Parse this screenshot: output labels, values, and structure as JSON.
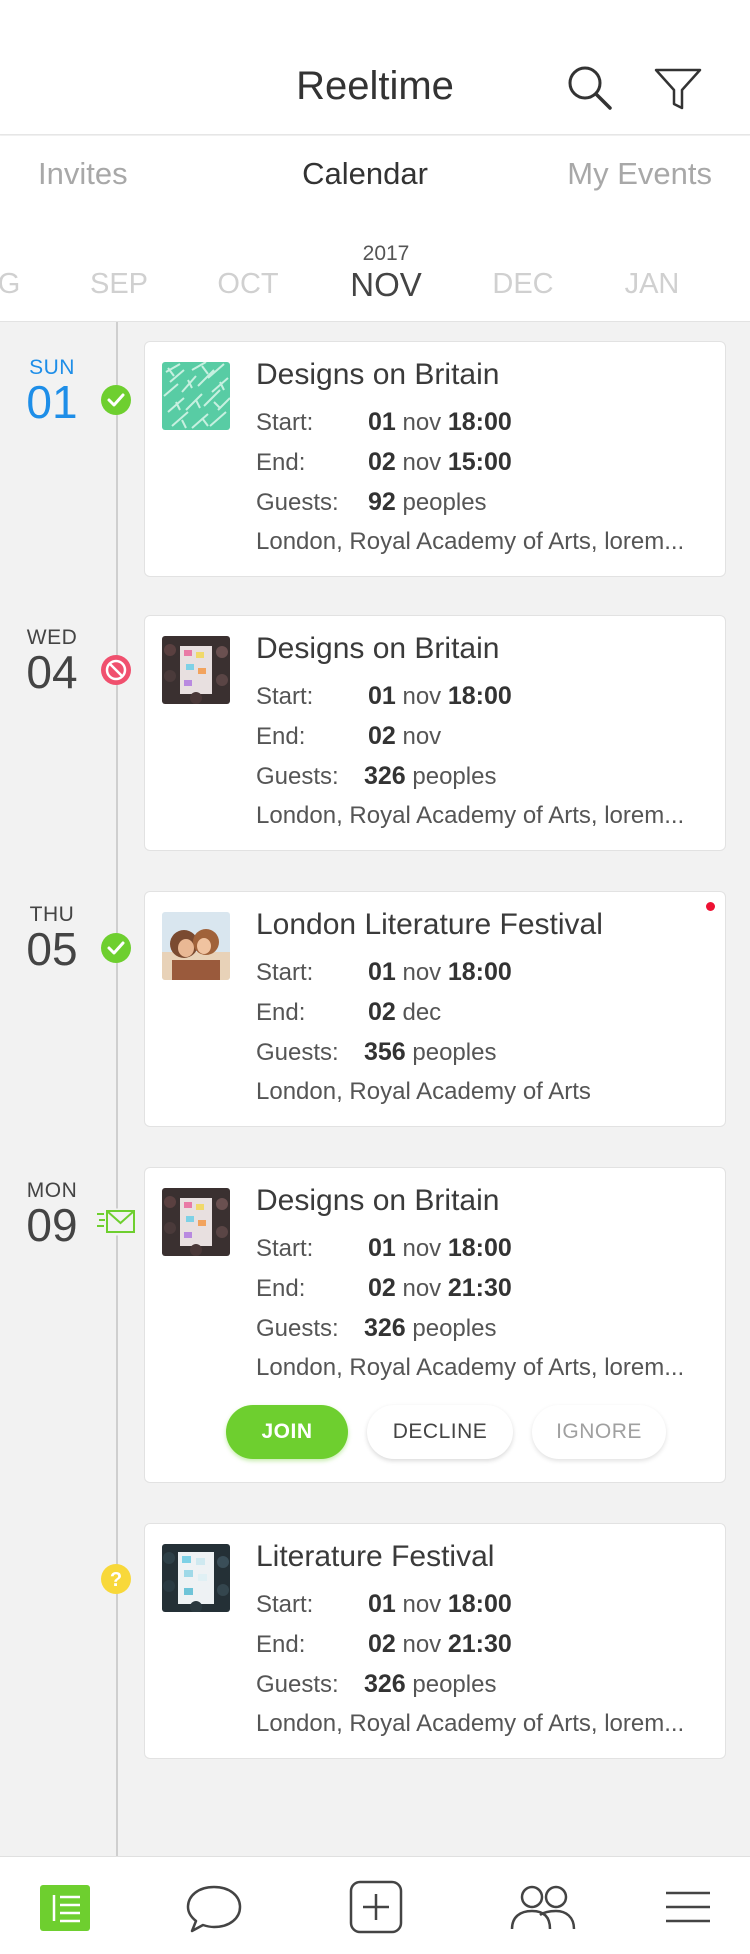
{
  "header": {
    "title": "Reeltime",
    "search_icon": "search-icon",
    "filter_icon": "filter-icon"
  },
  "tabs": [
    {
      "label": "Invites",
      "active": false
    },
    {
      "label": "Calendar",
      "active": true
    },
    {
      "label": "My Events",
      "active": false
    }
  ],
  "months": {
    "year": "2017",
    "items": [
      "G",
      "SEP",
      "OCT",
      "NOV",
      "DEC",
      "JAN"
    ],
    "selected": "NOV"
  },
  "colors": {
    "accent_green": "#6ecf2f",
    "today_blue": "#1e8ee8",
    "declined_red": "#f0506e",
    "pending_yellow": "#f8d83a",
    "unread_red": "#ee1133"
  },
  "labels": {
    "start": "Start:",
    "end": "End:",
    "guests": "Guests:"
  },
  "events": [
    {
      "day": {
        "dow": "SUN",
        "num": "01",
        "today": true
      },
      "status": "accepted-check-icon",
      "thumb": "pattern-thumbnail",
      "title": "Designs on Britain",
      "start": {
        "day": "01",
        "mon": "nov",
        "time": "18:00"
      },
      "end": {
        "day": "02",
        "mon": "nov",
        "time": "15:00"
      },
      "guests": {
        "count": "92",
        "unit": "peoples"
      },
      "address": "London, Royal Academy of Arts, lorem..."
    },
    {
      "day": {
        "dow": "WED",
        "num": "04",
        "today": false
      },
      "status": "declined-block-icon",
      "thumb": "crowd-photo-thumbnail",
      "title": "Designs on Britain",
      "start": {
        "day": "01",
        "mon": "nov",
        "time": "18:00"
      },
      "end": {
        "day": "02",
        "mon": "nov",
        "time": ""
      },
      "guests": {
        "count": "326",
        "unit": "peoples"
      },
      "address": "London, Royal Academy of Arts, lorem..."
    },
    {
      "day": {
        "dow": "THU",
        "num": "05",
        "today": false
      },
      "status": "accepted-check-icon",
      "thumb": "couple-photo-thumbnail",
      "title": "London Literature Festival",
      "start": {
        "day": "01",
        "mon": "nov",
        "time": "18:00"
      },
      "end": {
        "day": "02",
        "mon": "dec",
        "time": ""
      },
      "guests": {
        "count": "356",
        "unit": "peoples"
      },
      "address": "London, Royal Academy  of Arts",
      "unread": true
    },
    {
      "day": {
        "dow": "MON",
        "num": "09",
        "today": false
      },
      "status": "invite-envelope-icon",
      "thumb": "crowd-photo-thumbnail",
      "title": "Designs on Britain",
      "start": {
        "day": "01",
        "mon": "nov",
        "time": "18:00"
      },
      "end": {
        "day": "02",
        "mon": "nov",
        "time": "21:30"
      },
      "guests": {
        "count": "326",
        "unit": "peoples"
      },
      "address": "London, Royal Academy of Arts, lorem...",
      "actions": {
        "join": "JOIN",
        "decline": "DECLINE",
        "ignore": "IGNORE"
      }
    },
    {
      "day": {
        "dow": "",
        "num": "",
        "today": false
      },
      "status": "pending-question-icon",
      "thumb": "crowd-photo-thumbnail",
      "title": "Literature Festival",
      "start": {
        "day": "01",
        "mon": "nov",
        "time": "18:00"
      },
      "end": {
        "day": "02",
        "mon": "nov",
        "time": "21:30"
      },
      "guests": {
        "count": "326",
        "unit": "peoples"
      },
      "address": "London, Royal Academy of Arts, lorem..."
    }
  ],
  "bottom_nav": [
    {
      "icon": "calendar-list-icon",
      "active": true
    },
    {
      "icon": "chat-bubble-icon",
      "active": false
    },
    {
      "icon": "add-square-icon",
      "active": false
    },
    {
      "icon": "people-icon",
      "active": false
    },
    {
      "icon": "menu-icon",
      "active": false
    }
  ]
}
